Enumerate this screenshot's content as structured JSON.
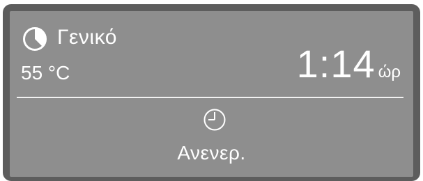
{
  "display": {
    "program": {
      "icon": "program-pie-icon",
      "name": "Γενικό"
    },
    "temperature": "55 °C",
    "duration": {
      "value": "1:14",
      "unit": "ώρ"
    },
    "delay_start": {
      "icon": "timer-clock-icon",
      "status": "Ανενερ."
    }
  },
  "colors": {
    "bezel": "#5d5d5d",
    "screen_background": "#8e8e8e",
    "text": "#ffffff"
  }
}
